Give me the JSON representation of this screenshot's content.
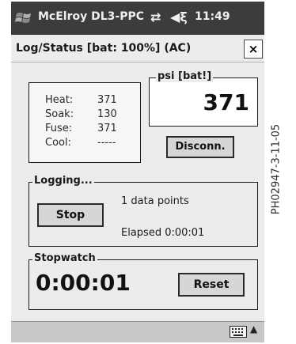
{
  "statusbar": {
    "app_name": "McElroy DL3-PPC",
    "icons": [
      "network-icon",
      "volume-icon"
    ],
    "time": "11:49"
  },
  "dialog": {
    "title": "Log/Status  [bat: 100%] (AC)",
    "close_label": "×"
  },
  "readings": [
    {
      "label": "Heat:",
      "value": "371"
    },
    {
      "label": "Soak:",
      "value": "130"
    },
    {
      "label": "Fuse:",
      "value": "371"
    },
    {
      "label": "Cool:",
      "value": "-----"
    }
  ],
  "psi": {
    "label": "psi [bat!]",
    "value": "371"
  },
  "disconnect_label": "Disconn.",
  "logging": {
    "label": "Logging...",
    "stop_label": "Stop",
    "points_text": "1 data points",
    "elapsed_text": "Elapsed 0:00:01"
  },
  "stopwatch": {
    "label": "Stopwatch",
    "time": "0:00:01",
    "reset_label": "Reset"
  },
  "taskbar": {
    "icons": [
      "keyboard-icon",
      "up-arrow-icon"
    ],
    "arrow_glyph": "▲"
  },
  "photo_id": "PH02947-3-11-05"
}
